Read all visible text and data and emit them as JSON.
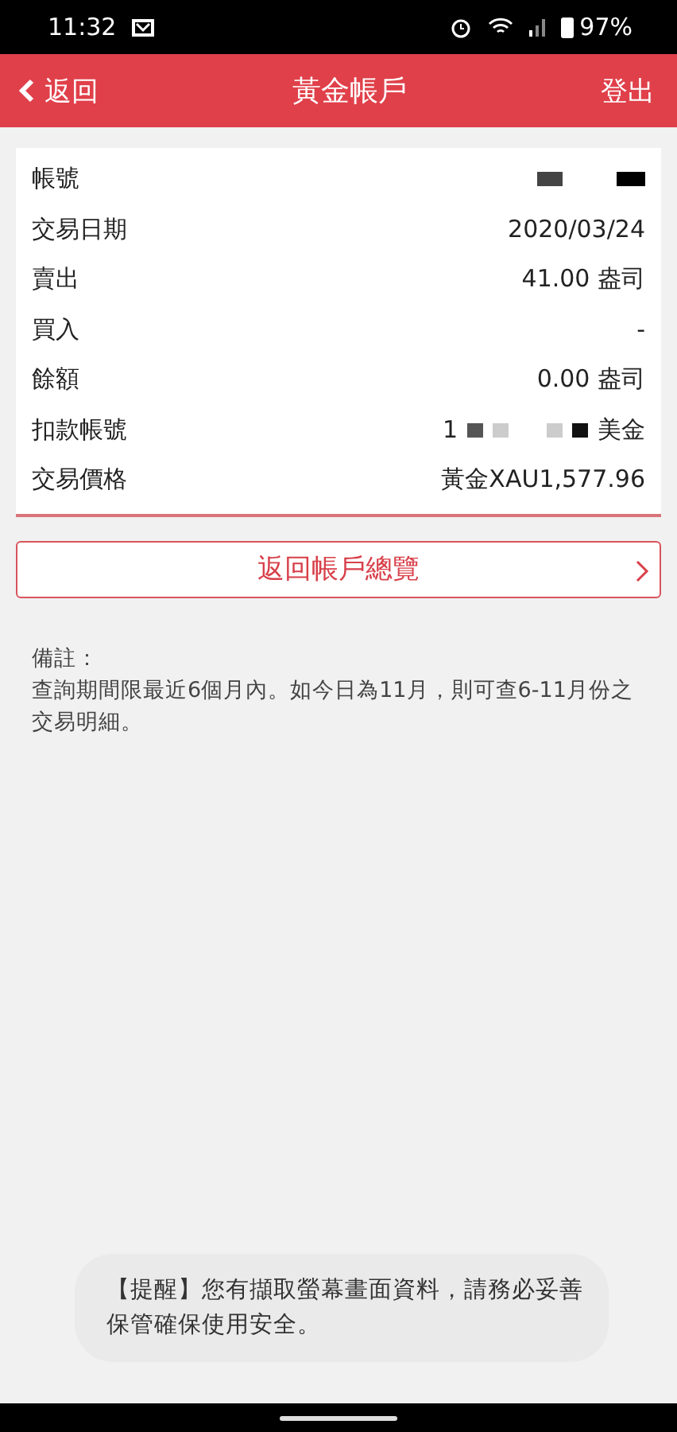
{
  "status_bar": {
    "time": "11:32",
    "battery": "97%"
  },
  "header": {
    "back": "返回",
    "title": "黃金帳戶",
    "logout": "登出"
  },
  "rows": [
    {
      "label": "帳號",
      "kind": "masked"
    },
    {
      "label": "交易日期",
      "kind": "text",
      "value": "2020/03/24"
    },
    {
      "label": "賣出",
      "kind": "text",
      "value": "41.00 盎司"
    },
    {
      "label": "買入",
      "kind": "text",
      "value": "-"
    },
    {
      "label": "餘額",
      "kind": "text",
      "value": "0.00 盎司"
    },
    {
      "label": "扣款帳號",
      "kind": "masked",
      "prefix": "1",
      "suffix": "美金"
    },
    {
      "label": "交易價格",
      "kind": "text",
      "value": "黃金XAU1,577.96"
    }
  ],
  "overview_button": "返回帳戶總覽",
  "note": {
    "title": "備註：",
    "text": "查詢期間限最近6個月內。如今日為11月，則可查6-11月份之交易明細。"
  },
  "toast": "【提醒】您有擷取螢幕畫面資料，請務必妥善保管確保使用安全。"
}
